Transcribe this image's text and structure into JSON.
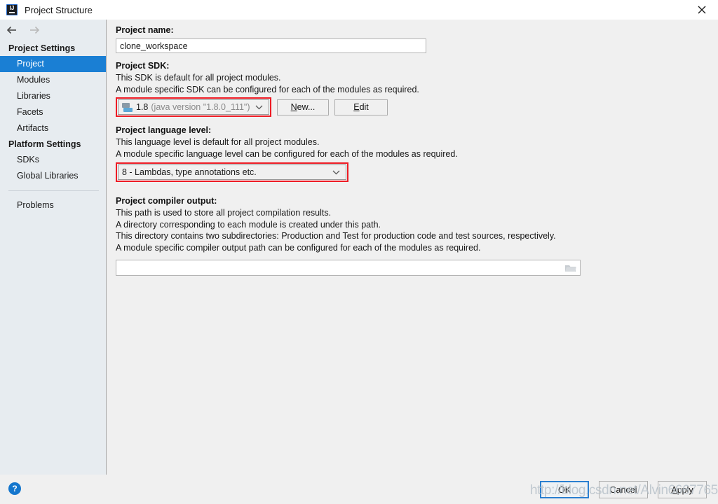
{
  "window": {
    "title": "Project Structure",
    "app_icon": "intellij-idea-icon",
    "close_icon": "close-icon"
  },
  "nav": {
    "back_icon": "arrow-left-icon",
    "forward_icon": "arrow-right-icon"
  },
  "sidebar": {
    "groups": [
      {
        "label": "Project Settings",
        "items": [
          {
            "label": "Project",
            "selected": true
          },
          {
            "label": "Modules",
            "selected": false
          },
          {
            "label": "Libraries",
            "selected": false
          },
          {
            "label": "Facets",
            "selected": false
          },
          {
            "label": "Artifacts",
            "selected": false
          }
        ]
      },
      {
        "label": "Platform Settings",
        "items": [
          {
            "label": "SDKs",
            "selected": false
          },
          {
            "label": "Global Libraries",
            "selected": false
          }
        ]
      }
    ],
    "problems_label": "Problems"
  },
  "main": {
    "project_name": {
      "label": "Project name:",
      "value": "clone_workspace"
    },
    "project_sdk": {
      "label": "Project SDK:",
      "desc_line_1": "This SDK is default for all project modules.",
      "desc_line_2": "A module specific SDK can be configured for each of the modules as required.",
      "selected_version": "1.8",
      "selected_detail": "(java version \"1.8.0_111\")",
      "sdk_icon": "jdk-icon",
      "chevron_icon": "chevron-down-icon",
      "new_button": "New...",
      "new_button_mnemonic": "N",
      "edit_button": "Edit",
      "edit_button_mnemonic": "E",
      "highlight_color": "#ee1c25"
    },
    "language_level": {
      "label": "Project language level:",
      "desc_line_1": "This language level is default for all project modules.",
      "desc_line_2": "A module specific language level can be configured for each of the modules as required.",
      "selected": "8 - Lambdas, type annotations etc.",
      "chevron_icon": "chevron-down-icon",
      "highlight_color": "#ee1c25"
    },
    "compiler_output": {
      "label": "Project compiler output:",
      "desc_line_1": "This path is used to store all project compilation results.",
      "desc_line_2": "A directory corresponding to each module is created under this path.",
      "desc_line_3": "This directory contains two subdirectories: Production and Test for production code and test sources, respectively.",
      "desc_line_4": "A module specific compiler output path can be configured for each of the modules as required.",
      "value": "",
      "browse_icon": "folder-icon"
    }
  },
  "footer": {
    "help_icon": "help-icon",
    "help_label": "?",
    "ok_label": "OK",
    "cancel_label": "Cancel",
    "apply_label": "Apply",
    "apply_mnemonic": "A"
  },
  "watermark": {
    "text": "http://blog.csdn.net/Alvin6667765"
  }
}
